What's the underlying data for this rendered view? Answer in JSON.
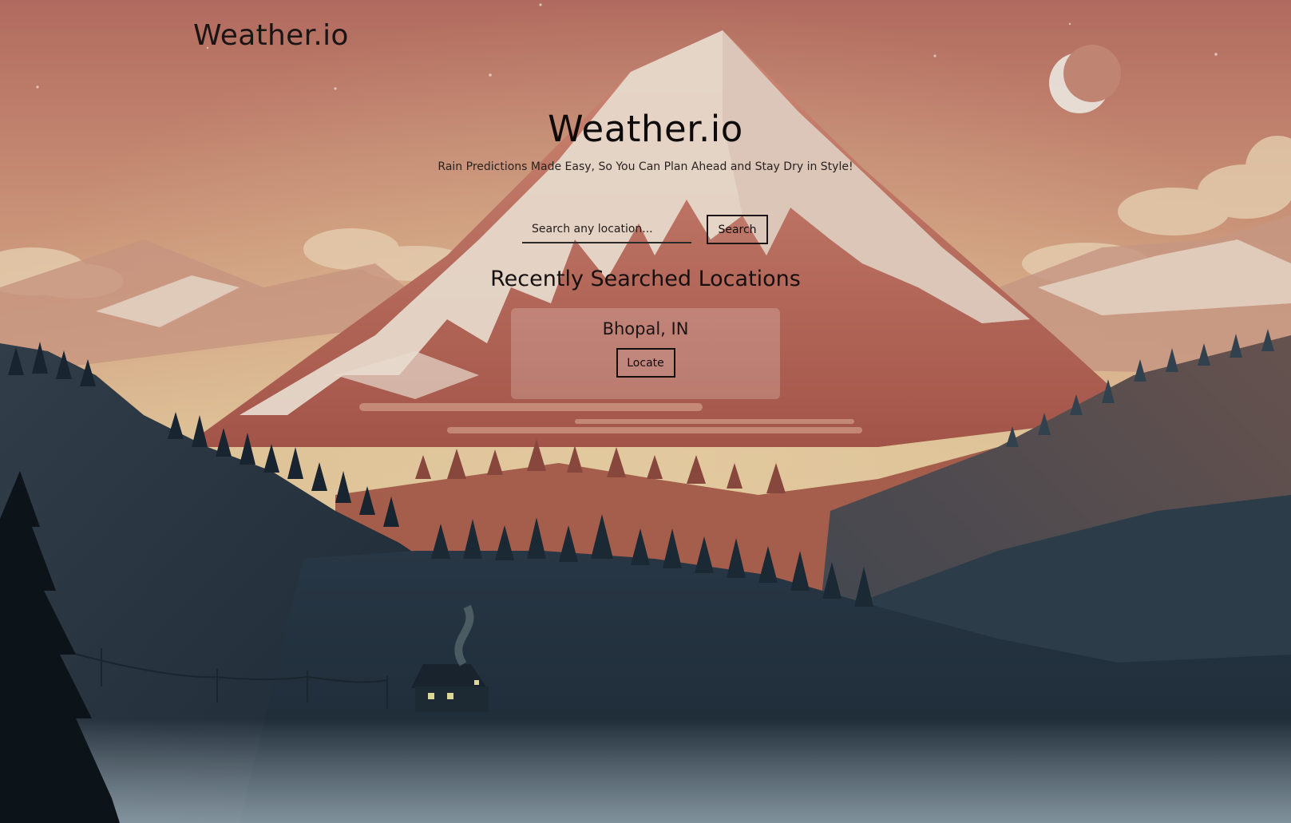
{
  "header": {
    "brand": "Weather.io"
  },
  "hero": {
    "title": "Weather.io",
    "tagline": "Rain Predictions Made Easy, So You Can Plan Ahead and Stay Dry in Style!"
  },
  "search": {
    "placeholder": "Search any location...",
    "value": "",
    "button_label": "Search"
  },
  "recent": {
    "heading": "Recently Searched Locations",
    "items": [
      {
        "location": "Bhopal, IN",
        "button_label": "Locate"
      }
    ]
  },
  "background": {
    "sky_top": "#b56a60",
    "sky_bottom": "#ead2a6",
    "mountain": "#c86e5e",
    "snow": "#f0e2d2",
    "forest_dark": "#1d2d3a",
    "moon": "#f3ece6"
  }
}
